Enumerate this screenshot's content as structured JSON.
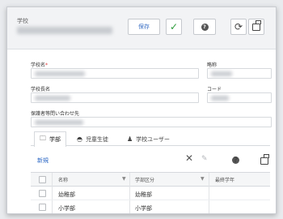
{
  "header": {
    "title_label": "学校",
    "save_label": "保存"
  },
  "form": {
    "school_name_label": "学校名",
    "required_mark": "*",
    "abbreviation_label": "略称",
    "principal_label": "学校長名",
    "code_label": "コード",
    "contact_label": "保護者等問い合わせ先"
  },
  "tabs": [
    {
      "label": "学部",
      "icon": "folder-icon",
      "active": true
    },
    {
      "label": "児童生徒",
      "icon": "student-icon",
      "active": false
    },
    {
      "label": "学校ユーザー",
      "icon": "users-icon",
      "active": false
    }
  ],
  "subtoolbar": {
    "new_label": "新規"
  },
  "table": {
    "columns": [
      "名称",
      "学部区分",
      "最終学年"
    ],
    "rows": [
      {
        "name": "幼稚部",
        "category": "幼稚部"
      },
      {
        "name": "小学部",
        "category": "小学部"
      }
    ]
  },
  "colors": {
    "accent": "#2a66c4",
    "check": "#2e9c3b"
  }
}
